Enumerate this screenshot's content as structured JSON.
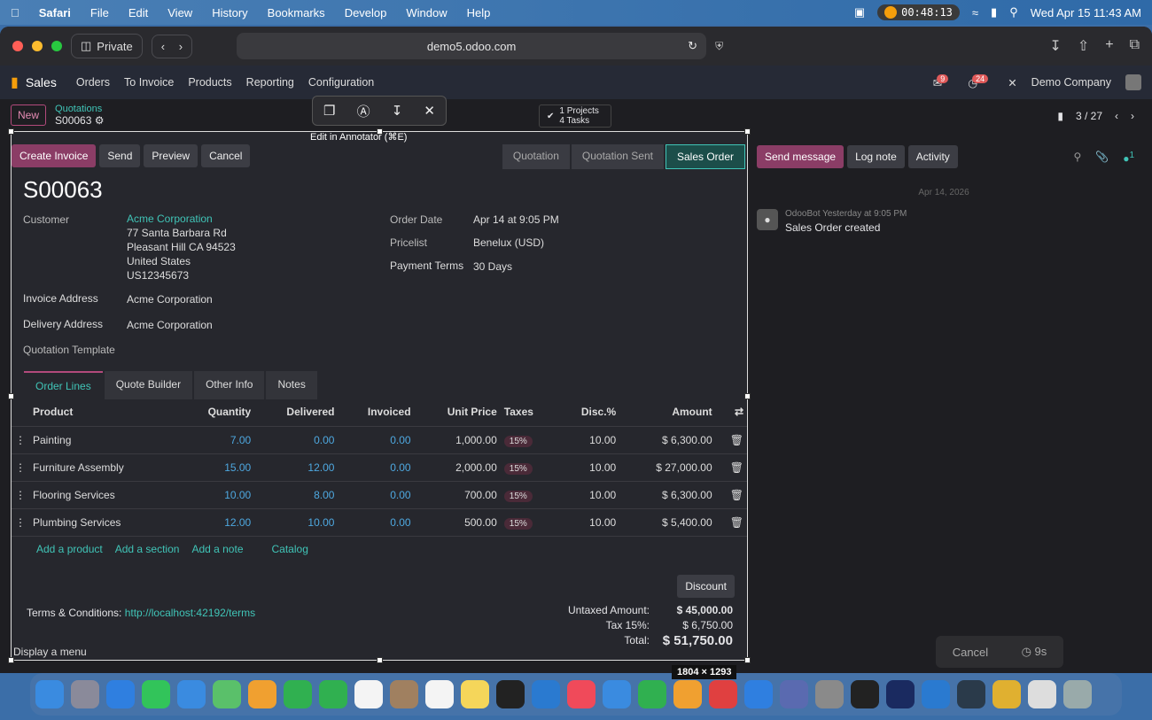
{
  "macos": {
    "menu": [
      "Safari",
      "File",
      "Edit",
      "View",
      "History",
      "Bookmarks",
      "Develop",
      "Window",
      "Help"
    ],
    "timer": "00:48:13",
    "clock": "Wed Apr 15  11:43 AM"
  },
  "browser": {
    "private_label": "Private",
    "url": "demo5.odoo.com"
  },
  "odoo_nav": {
    "app": "Sales",
    "menus": [
      "Orders",
      "To Invoice",
      "Products",
      "Reporting",
      "Configuration"
    ],
    "company": "Demo Company",
    "msg_badge": "9",
    "activity_badge": "24"
  },
  "breadcrumb": {
    "new_label": "New",
    "parent": "Quotations",
    "record": "S00063"
  },
  "annotator": {
    "tooltip": "Edit in Annotator (⌘E)"
  },
  "smart": {
    "projects": "1 Projects",
    "tasks": "4 Tasks"
  },
  "pager": {
    "value": "3 / 27"
  },
  "actions": {
    "create_invoice": "Create Invoice",
    "send": "Send",
    "preview": "Preview",
    "cancel": "Cancel"
  },
  "status": [
    "Quotation",
    "Quotation Sent",
    "Sales Order"
  ],
  "order": {
    "name": "S00063",
    "customer_label": "Customer",
    "customer_name": "Acme Corporation",
    "addr1": "77 Santa Barbara Rd",
    "addr2": "Pleasant Hill CA 94523",
    "addr3": "United States",
    "addr4": "US12345673",
    "invoice_label": "Invoice Address",
    "invoice_val": "Acme Corporation",
    "delivery_label": "Delivery Address",
    "delivery_val": "Acme Corporation",
    "template_label": "Quotation Template",
    "order_date_label": "Order Date",
    "order_date": "Apr 14 at 9:05 PM",
    "pricelist_label": "Pricelist",
    "pricelist": "Benelux (USD)",
    "terms_label": "Payment Terms",
    "terms": "30 Days"
  },
  "tabs": [
    "Order Lines",
    "Quote Builder",
    "Other Info",
    "Notes"
  ],
  "lines": {
    "headers": [
      "Product",
      "Quantity",
      "Delivered",
      "Invoiced",
      "Unit Price",
      "Taxes",
      "Disc.%",
      "Amount"
    ],
    "rows": [
      [
        "Painting",
        "7.00",
        "0.00",
        "0.00",
        "1,000.00",
        "15%",
        "10.00",
        "$ 6,300.00"
      ],
      [
        "Furniture Assembly",
        "15.00",
        "12.00",
        "0.00",
        "2,000.00",
        "15%",
        "10.00",
        "$ 27,000.00"
      ],
      [
        "Flooring Services",
        "10.00",
        "8.00",
        "0.00",
        "700.00",
        "15%",
        "10.00",
        "$ 6,300.00"
      ],
      [
        "Plumbing Services",
        "12.00",
        "10.00",
        "0.00",
        "500.00",
        "15%",
        "10.00",
        "$ 5,400.00"
      ]
    ]
  },
  "add": {
    "product": "Add a product",
    "section": "Add a section",
    "note": "Add a note",
    "catalog": "Catalog"
  },
  "discount": "Discount",
  "terms_conditions": {
    "label": "Terms & Conditions:",
    "url": "http://localhost:42192/terms"
  },
  "totals": {
    "untaxed_label": "Untaxed Amount:",
    "untaxed": "$ 45,000.00",
    "tax_label": "Tax 15%:",
    "tax": "$ 6,750.00",
    "total_label": "Total:",
    "total": "$ 51,750.00"
  },
  "display_menu": "Display a menu",
  "chatter": {
    "send": "Send message",
    "log": "Log note",
    "activity": "Activity",
    "date": "Apr 14, 2026",
    "author": "OdooBot",
    "time": "Yesterday at 9:05 PM",
    "message": "Sales Order created",
    "follower_count": "1"
  },
  "toast": {
    "cancel": "Cancel",
    "countdown": "9s"
  },
  "screenshot_dims": "1804 × 1293"
}
